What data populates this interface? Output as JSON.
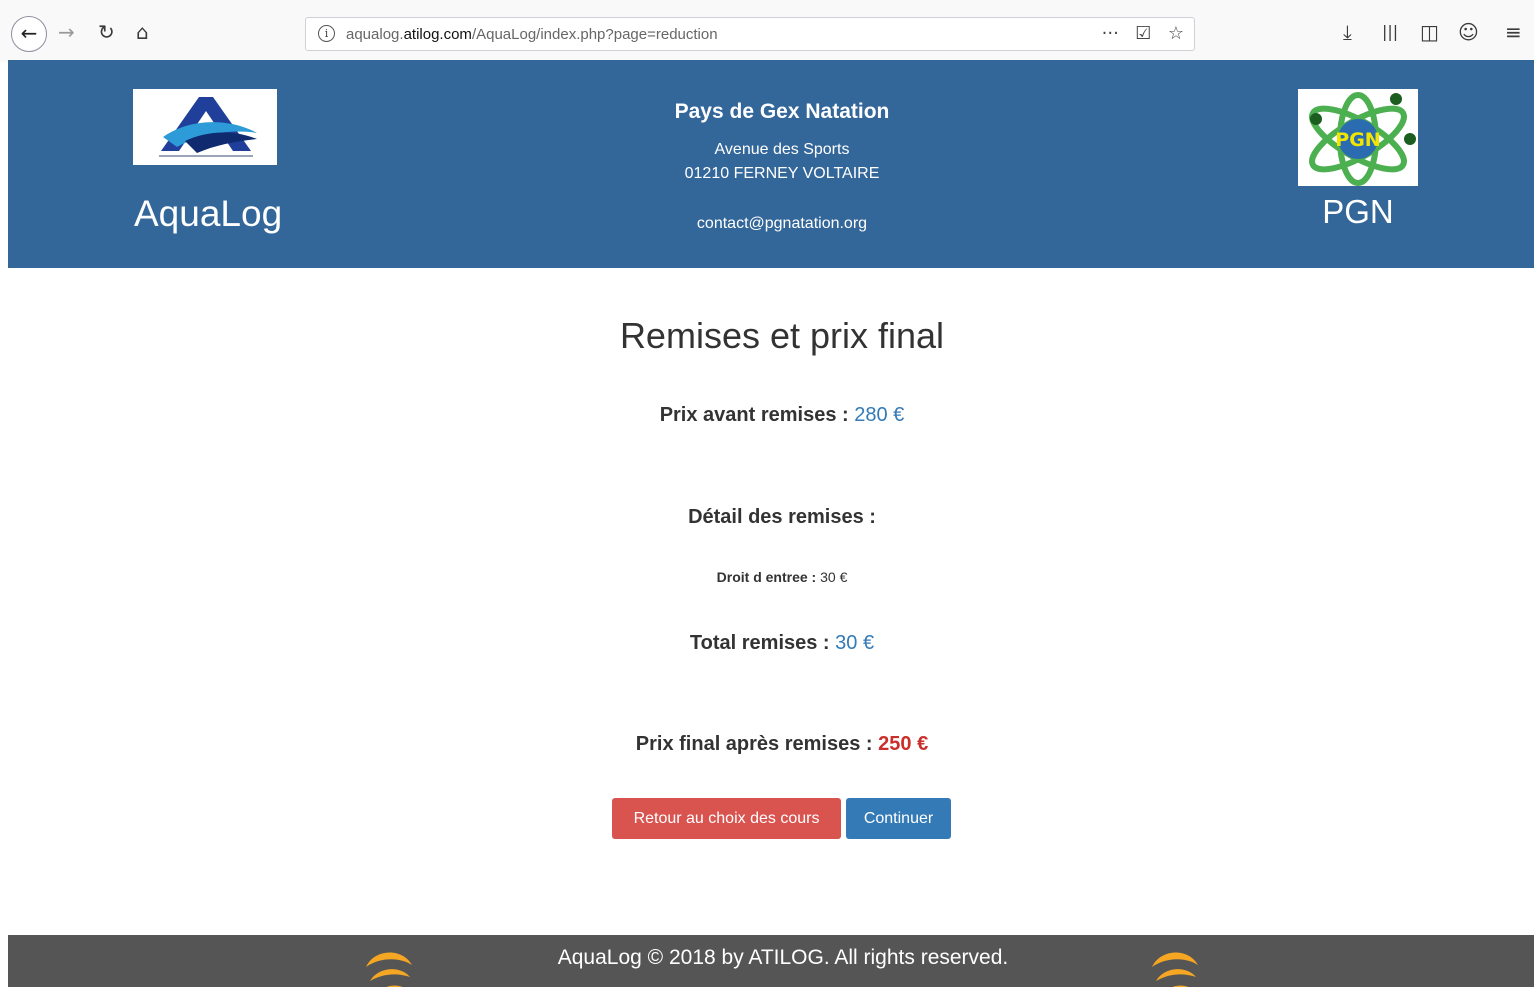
{
  "browser": {
    "url_prefix": "aqualog.",
    "url_domain": "atilog.com",
    "url_path": "/AquaLog/index.php?page=reduction"
  },
  "header": {
    "brand_left": "AquaLog",
    "brand_right": "PGN",
    "club_name": "Pays de Gex Natation",
    "street": "Avenue des Sports",
    "city": "01210 FERNEY VOLTAIRE",
    "email": "contact@pgnatation.org",
    "logo_right_text": "PGN"
  },
  "main": {
    "title": "Remises et prix final",
    "prix_avant_label": "Prix avant remises :",
    "prix_avant_value": "280 €",
    "detail_label": "Détail des remises :",
    "droit_label": "Droit d entree :",
    "droit_value": "30 €",
    "total_label": "Total remises :",
    "total_value": "30 €",
    "final_label": "Prix final après remises :",
    "final_value": "250 €",
    "btn_back": "Retour au choix des cours",
    "btn_next": "Continuer"
  },
  "footer": {
    "text": "AquaLog © 2018 by ATILOG. All rights reserved."
  },
  "colors": {
    "header_bg": "#336699",
    "footer_bg": "#555555",
    "primary": "#337ab7",
    "danger": "#d9534f",
    "final_price": "#c9302c"
  }
}
